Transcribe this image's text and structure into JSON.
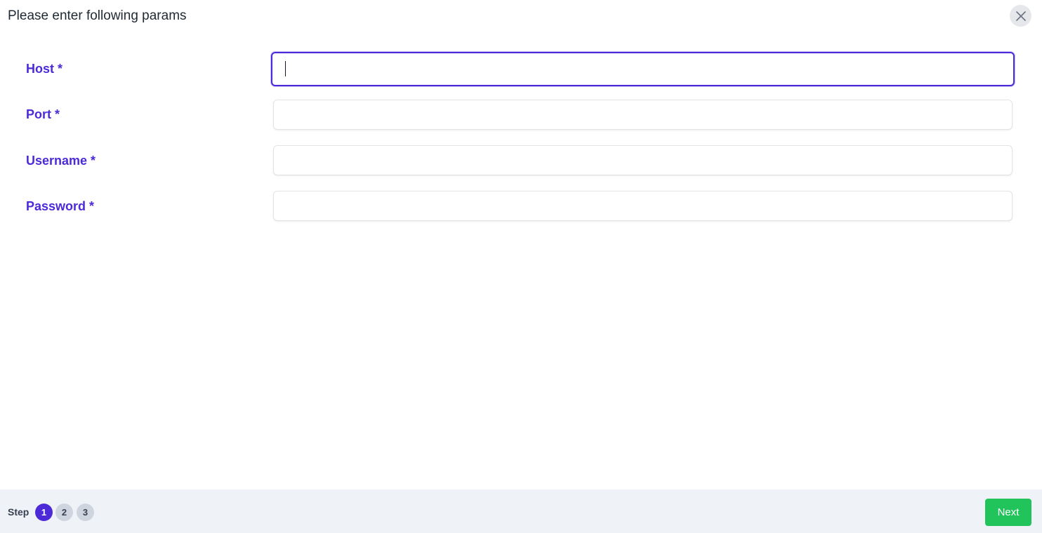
{
  "dialog": {
    "title": "Please enter following params",
    "close_icon": "close-icon"
  },
  "form": {
    "fields": [
      {
        "label": "Host *",
        "value": "",
        "focused": true
      },
      {
        "label": "Port *",
        "value": ""
      },
      {
        "label": "Username *",
        "value": ""
      },
      {
        "label": "Password *",
        "value": ""
      }
    ]
  },
  "footer": {
    "step_label": "Step",
    "steps": [
      "1",
      "2",
      "3"
    ],
    "active_step": "1",
    "next_label": "Next"
  },
  "colors": {
    "accent": "#4c2ad8",
    "next_button": "#21c35b",
    "footer_bg": "#eff2f6"
  }
}
